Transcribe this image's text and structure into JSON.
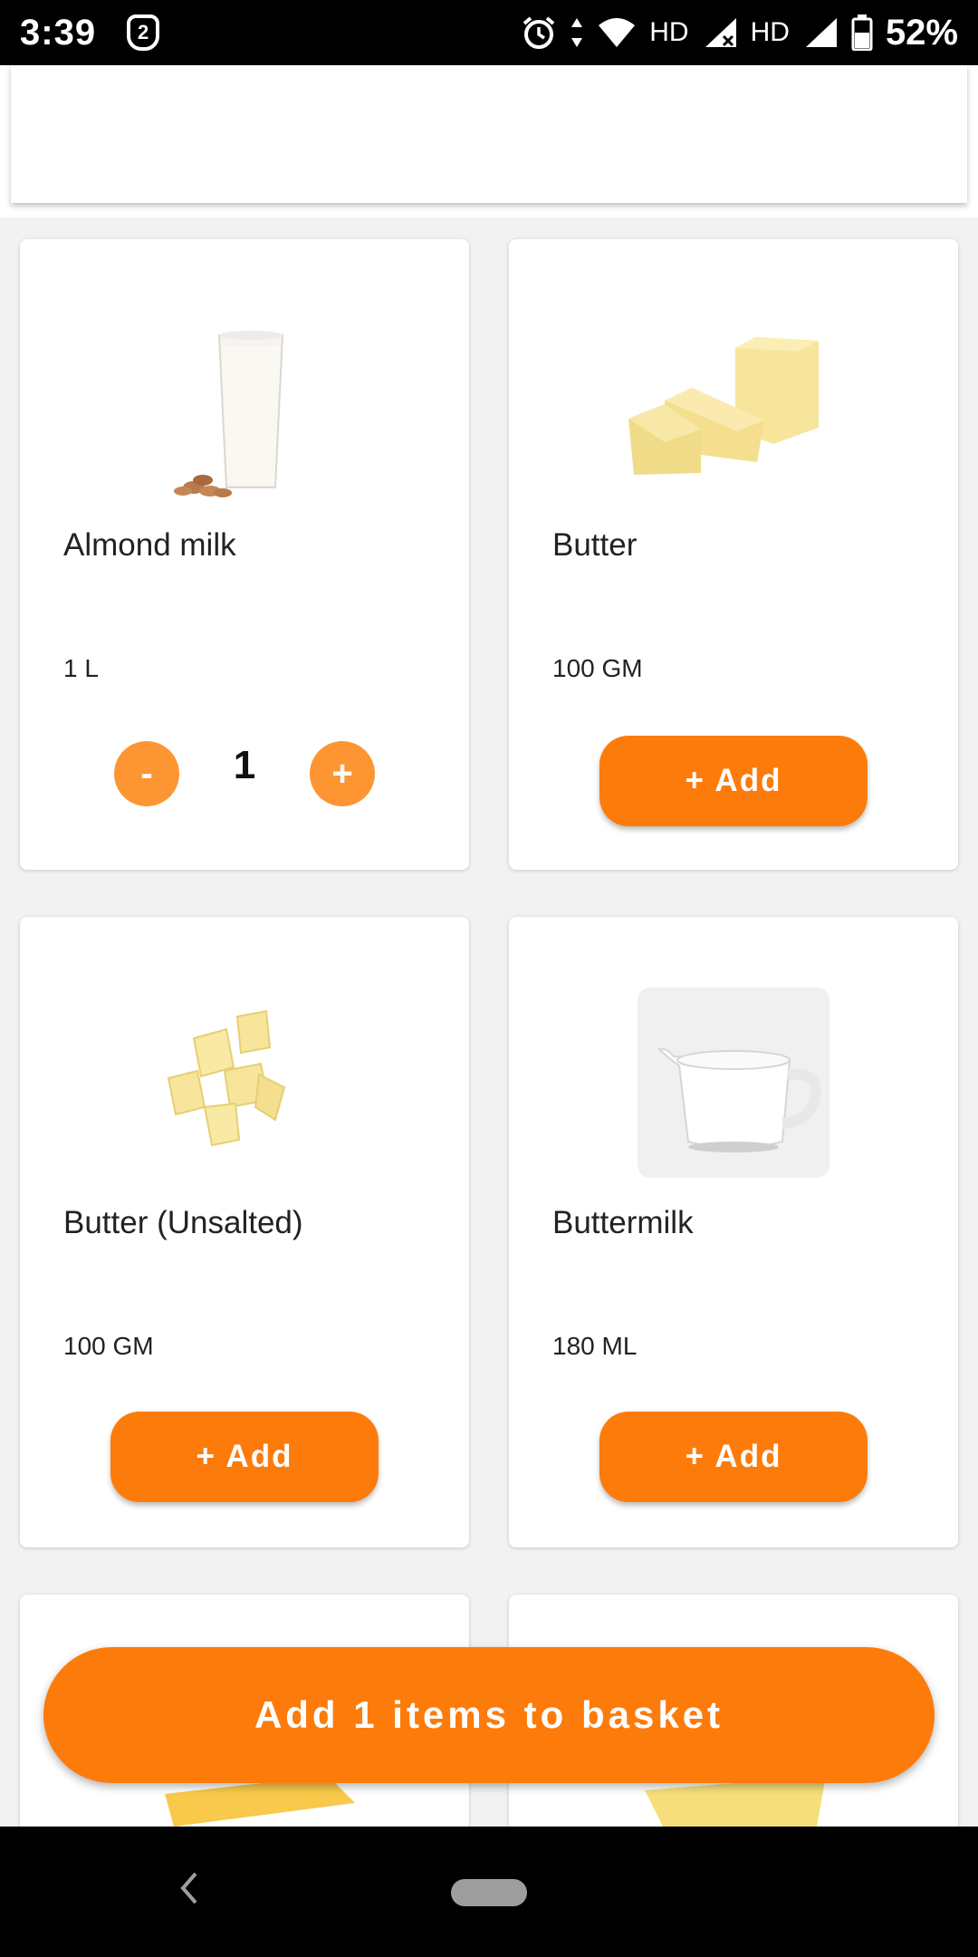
{
  "status_bar": {
    "time": "3:39",
    "notification_count": "2",
    "network_1": "HD",
    "network_2": "HD",
    "battery": "52%"
  },
  "products": [
    {
      "name": "Almond milk",
      "quantity": "1 L",
      "image": "almond-milk-glass-image",
      "in_basket": true,
      "count": "1"
    },
    {
      "name": "Butter",
      "quantity": "100 GM",
      "image": "butter-blocks-image",
      "in_basket": false,
      "add_label": "+ Add"
    },
    {
      "name": "Butter (Unsalted)",
      "quantity": "100 GM",
      "image": "butter-cubes-image",
      "in_basket": false,
      "add_label": "+ Add"
    },
    {
      "name": "Buttermilk",
      "quantity": "180 ML",
      "image": "buttermilk-jug-image",
      "in_basket": false,
      "add_label": "+ Add"
    }
  ],
  "stepper": {
    "minus": "-",
    "plus": "+"
  },
  "basket_button": {
    "label": "Add 1 items to basket"
  },
  "colors": {
    "accent": "#fd7b0b",
    "stepper": "#fd9533"
  }
}
